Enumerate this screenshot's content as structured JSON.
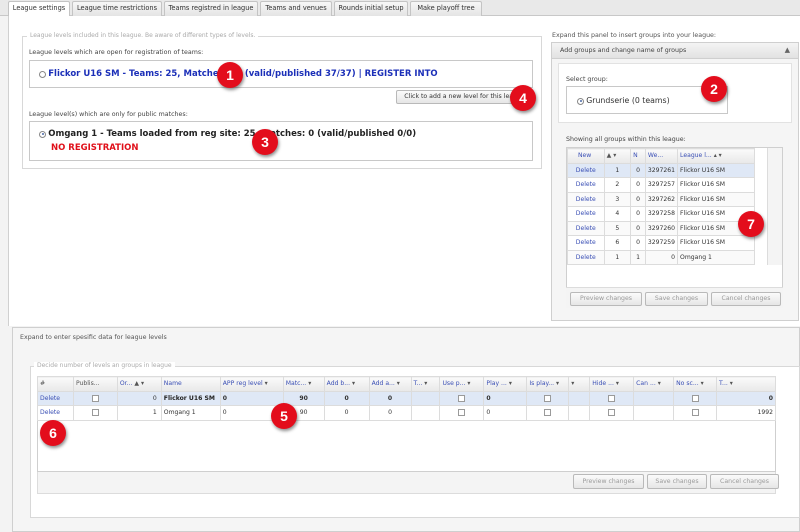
{
  "tabs": [
    {
      "label": "League settings",
      "active": true
    },
    {
      "label": "League time restrictions"
    },
    {
      "label": "Teams registred in league"
    },
    {
      "label": "Teams and venues"
    },
    {
      "label": "Rounds initial setup"
    },
    {
      "label": "Make playoff tree"
    }
  ],
  "levels_fieldset": {
    "legend": "League levels included in this league. Be aware of different types of levels.",
    "open_label": "League levels which are open for registration of teams:",
    "open_item_text": "Flickor U16 SM - Teams: 25, Matches: 90 (valid/published 37/37) | REGISTER INTO",
    "add_level_button": "Click to add a new level for this league",
    "public_label": "League level(s) which are only for public matches:",
    "public_item_text": "Omgang 1 - Teams loaded from reg site: 25, Matches: 0 (valid/published 0/0)",
    "no_registration": "NO REGISTRATION"
  },
  "groups_panel": {
    "expand_label": "Expand this panel to insert groups into your league:",
    "header": "Add groups and change name of groups",
    "select_group_label": "Select group:",
    "selected_group": "Grundserie (0 teams)",
    "showing_label": "Showing all groups within this league:",
    "columns": [
      "New",
      "",
      "N",
      "We...",
      "League l..."
    ],
    "rows": [
      {
        "action": "Delete",
        "order": "1",
        "n": "0",
        "id": "3297261",
        "league": "Flickor U16 SM"
      },
      {
        "action": "Delete",
        "order": "2",
        "n": "0",
        "id": "3297257",
        "league": "Flickor U16 SM"
      },
      {
        "action": "Delete",
        "order": "3",
        "n": "0",
        "id": "3297262",
        "league": "Flickor U16 SM"
      },
      {
        "action": "Delete",
        "order": "4",
        "n": "0",
        "id": "3297258",
        "league": "Flickor U16 SM"
      },
      {
        "action": "Delete",
        "order": "5",
        "n": "0",
        "id": "3297260",
        "league": "Flickor U16 SM"
      },
      {
        "action": "Delete",
        "order": "6",
        "n": "0",
        "id": "3297259",
        "league": "Flickor U16 SM"
      },
      {
        "action": "Delete",
        "order": "1",
        "n": "1",
        "id": "0",
        "league": "Omgang 1"
      }
    ],
    "buttons": {
      "preview": "Preview changes",
      "save": "Save changes",
      "cancel": "Cancel changes"
    }
  },
  "bottom_panel": {
    "expand_label": "Expand to enter spesific data for league levels",
    "legend": "Decide number of levels an groups in league",
    "columns": [
      "#",
      "Publis...",
      "Or...",
      "Name",
      "APP reg level",
      "Matc...",
      "Add b...",
      "Add a...",
      "T...",
      "Use p...",
      "Play ...",
      "Is play...",
      "",
      "Hide ...",
      "Can ...",
      "No sc...",
      "T..."
    ],
    "rows": [
      {
        "action": "Delete",
        "order": "0",
        "name": "Flickor U16 SM",
        "app": "0",
        "matches": "90",
        "add_b": "0",
        "add_a": "0",
        "play": "0",
        "t_last": "0"
      },
      {
        "action": "Delete",
        "order": "1",
        "name": "Omgang 1",
        "app": "0",
        "matches": "90",
        "add_b": "0",
        "add_a": "0",
        "play": "0",
        "t_last": "1992"
      }
    ],
    "buttons": {
      "preview": "Preview changes",
      "save": "Save changes",
      "cancel": "Cancel changes"
    }
  },
  "callouts": [
    "1",
    "2",
    "3",
    "4",
    "5",
    "6",
    "7"
  ],
  "colors": {
    "accent_blue": "#1b2fb8",
    "alert_red": "#e0101a",
    "badge_red": "#e30d1c",
    "selected_row": "#dfe8f6"
  }
}
